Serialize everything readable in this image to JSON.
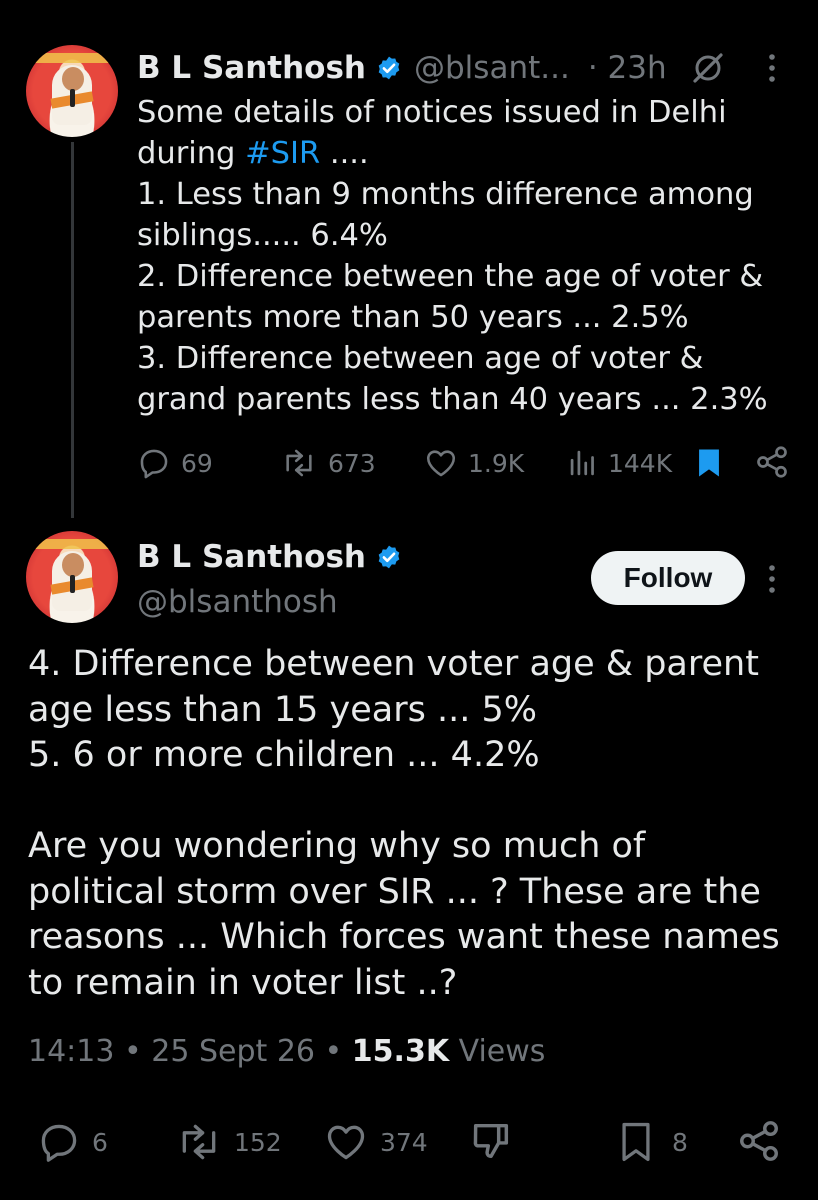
{
  "tweet1": {
    "author_name": "B L Santhosh",
    "handle": "@blsant...",
    "dot_time": "· 23h",
    "text_before_hashtag": "Some details of notices issued in Delhi\nduring ",
    "hashtag": "#SIR",
    "text_after_hashtag": " ....\n1. Less than 9 months difference among\nsiblings..... 6.4%\n2. Difference between the age of voter &\nparents more than 50 years ... 2.5%\n3. Difference between age of voter &\ngrand parents less than 40 years ... 2.3%",
    "replies": "69",
    "reposts": "673",
    "likes": "1.9K",
    "views": "144K"
  },
  "tweet2": {
    "author_name": "B L Santhosh",
    "handle": "@blsanthosh",
    "follow_label": "Follow",
    "text": "4. Difference between voter age & parent\nage less than 15 years ... 5%\n5. 6 or more children ... 4.2%\n\nAre you wondering why so much of\npolitical storm over SIR ... ? These are the\nreasons ... Which forces want these names\nto remain in voter list ..?",
    "time": "14:13",
    "sep1": "•",
    "date": "25 Sept 26",
    "sep2": "•",
    "views_count": "15.3K",
    "views_label": "Views",
    "replies": "6",
    "reposts": "152",
    "likes": "374",
    "bookmarks": "8"
  },
  "icons": {
    "verified": "verified-badge-icon",
    "grok": "grok-icon",
    "more": "more-icon",
    "reply": "reply-icon",
    "repost": "repost-icon",
    "like": "like-icon",
    "views": "views-icon",
    "bookmark": "bookmark-icon",
    "share": "share-icon",
    "dislike": "dislike-icon"
  },
  "colors": {
    "background": "#000000",
    "text": "#e7e9ea",
    "muted": "#71767b",
    "accent": "#1d9bf0"
  }
}
